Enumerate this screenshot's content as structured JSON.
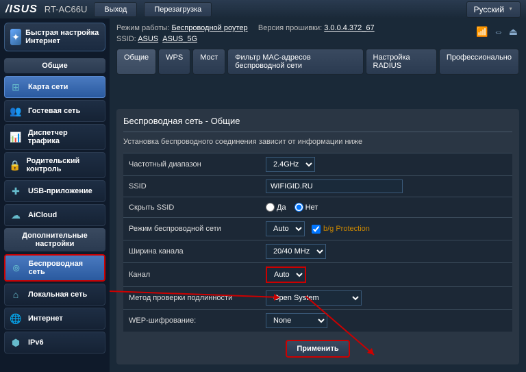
{
  "header": {
    "brand": "/ISUS",
    "model": "RT-AC66U",
    "logout": "Выход",
    "reboot": "Перезагрузка",
    "language": "Русский"
  },
  "info": {
    "mode_label": "Режим работы: ",
    "mode_value": "Беспроводной роутер",
    "fw_label": "Версия прошивки: ",
    "fw_value": "3.0.0.4.372_67",
    "ssid_label": "SSID: ",
    "ssid1": "ASUS",
    "ssid2": "ASUS_5G"
  },
  "tabs": [
    "Общие",
    "WPS",
    "Мост",
    "Фильтр MAC-адресов беспроводной сети",
    "Настройка RADIUS",
    "Профессионально"
  ],
  "sidebar": {
    "qis": "Быстрая настройка Интернет",
    "sec1": "Общие",
    "items1": [
      "Карта сети",
      "Гостевая сеть",
      "Диспетчер трафика",
      "Родительский контроль",
      "USB-приложение",
      "AiCloud"
    ],
    "sec2": "Дополнительные настройки",
    "items2": [
      "Беспроводная сеть",
      "Локальная сеть",
      "Интернет",
      "IPv6"
    ]
  },
  "panel": {
    "title": "Беспроводная сеть - Общие",
    "desc": "Установка беспроводного соединения зависит от информации ниже",
    "rows": {
      "band_label": "Частотный диапазон",
      "band_value": "2.4GHz",
      "ssid_label": "SSID",
      "ssid_value": "WIFIGID.RU",
      "hide_label": "Скрыть SSID",
      "yes": "Да",
      "no": "Нет",
      "wmode_label": "Режим беспроводной сети",
      "wmode_value": "Auto",
      "bg_prot": "b/g Protection",
      "width_label": "Ширина канала",
      "width_value": "20/40 MHz",
      "channel_label": "Канал",
      "channel_value": "Auto",
      "auth_label": "Метод проверки подлинности",
      "auth_value": "Open System",
      "wep_label": "WEP-шифрование:",
      "wep_value": "None"
    },
    "apply": "Применить"
  }
}
